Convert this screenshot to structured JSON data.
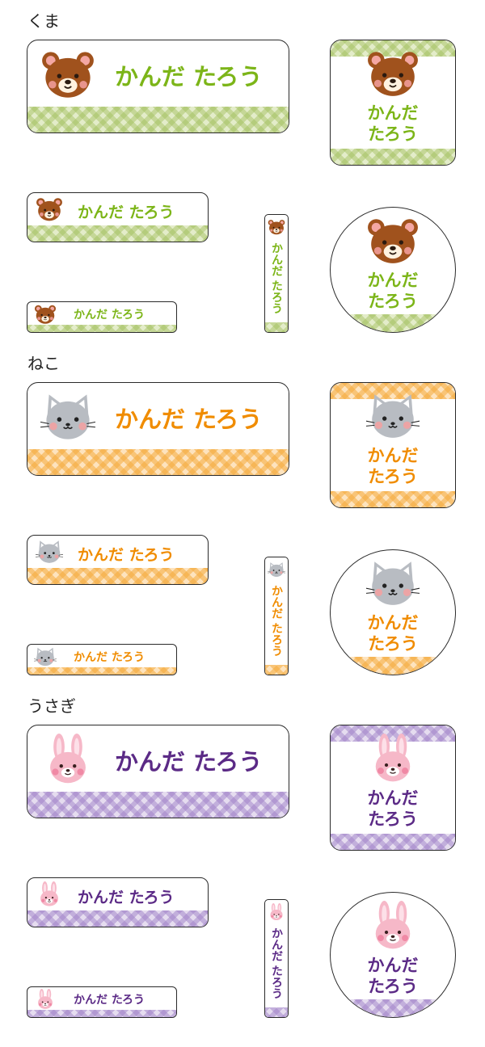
{
  "sections": [
    {
      "title": "くま",
      "animal": "bear",
      "theme": "green",
      "color": "#7cb518"
    },
    {
      "title": "ねこ",
      "animal": "cat",
      "theme": "orange",
      "color": "#f08c00"
    },
    {
      "title": "うさぎ",
      "animal": "rabbit",
      "theme": "purple",
      "color": "#5b2a86"
    }
  ],
  "name_text": "かんだ たろう",
  "name_line1": "かんだ",
  "name_line2": "たろう",
  "icons": {
    "bear": "bear-face-icon",
    "cat": "cat-face-icon",
    "rabbit": "rabbit-face-icon"
  }
}
